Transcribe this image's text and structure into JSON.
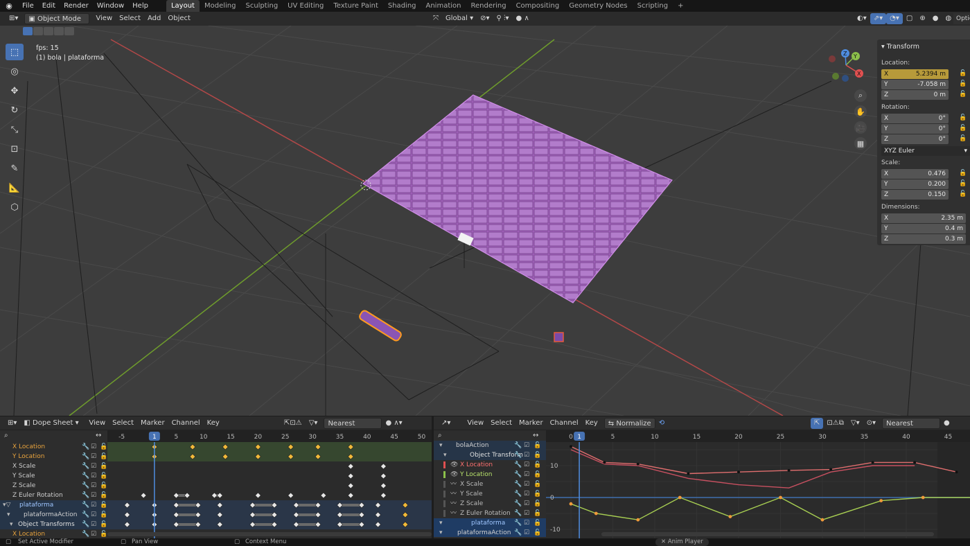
{
  "topbar": {
    "menus": [
      "File",
      "Edit",
      "Render",
      "Window",
      "Help"
    ],
    "workspaces": [
      "Layout",
      "Modeling",
      "Sculpting",
      "UV Editing",
      "Texture Paint",
      "Shading",
      "Animation",
      "Rendering",
      "Compositing",
      "Geometry Nodes",
      "Scripting"
    ],
    "active_workspace": "Layout",
    "add_tab": "+"
  },
  "viewport_header": {
    "mode": "Object Mode",
    "menus": [
      "View",
      "Select",
      "Add",
      "Object"
    ],
    "orientation": "Global",
    "options_label": "Optio"
  },
  "overlay": {
    "fps": "fps: 15",
    "object": "(1) bola | plataforma"
  },
  "gizmo": {
    "x": "X",
    "y": "Y",
    "z": "Z"
  },
  "npanel": {
    "title": "Transform",
    "location_label": "Location:",
    "location": [
      {
        "axis": "X",
        "value": "5.2394 m"
      },
      {
        "axis": "Y",
        "value": "-7.058 m"
      },
      {
        "axis": "Z",
        "value": "0 m"
      }
    ],
    "rotation_label": "Rotation:",
    "rotation": [
      {
        "axis": "X",
        "value": "0°"
      },
      {
        "axis": "Y",
        "value": "0°"
      },
      {
        "axis": "Z",
        "value": "0°"
      }
    ],
    "rotation_mode": "XYZ Euler",
    "scale_label": "Scale:",
    "scale": [
      {
        "axis": "X",
        "value": "0.476"
      },
      {
        "axis": "Y",
        "value": "0.200"
      },
      {
        "axis": "Z",
        "value": "0.150"
      }
    ],
    "dimensions_label": "Dimensions:",
    "dimensions": [
      {
        "axis": "X",
        "value": "2.35 m"
      },
      {
        "axis": "Y",
        "value": "0.4 m"
      },
      {
        "axis": "Z",
        "value": "0.3 m"
      }
    ]
  },
  "dopesheet": {
    "editor": "Dope Sheet",
    "menus": [
      "View",
      "Select",
      "Marker",
      "Channel",
      "Key"
    ],
    "snap": "Nearest Frame",
    "ruler": [
      "-5",
      "1",
      "5",
      "10",
      "15",
      "20",
      "25",
      "30",
      "35",
      "40",
      "45",
      "50"
    ],
    "current_frame": "1",
    "channels": [
      {
        "name": "X Location",
        "color": "#e8a33d",
        "indent": 18
      },
      {
        "name": "Y Location",
        "color": "#e8a33d",
        "indent": 18
      },
      {
        "name": "X Scale",
        "color": "#cccccc",
        "indent": 18
      },
      {
        "name": "Y Scale",
        "color": "#cccccc",
        "indent": 18
      },
      {
        "name": "Z Scale",
        "color": "#cccccc",
        "indent": 18
      },
      {
        "name": "Z Euler Rotation",
        "color": "#cccccc",
        "indent": 18
      },
      {
        "name": "plataforma",
        "color": "#9fc6ff",
        "indent": 28
      },
      {
        "name": "plataformaAction",
        "color": "#d0d0d0",
        "indent": 34
      },
      {
        "name": "Object Transforms",
        "color": "#e0e0e0",
        "indent": 26
      },
      {
        "name": "X Location",
        "color": "#e8a33d",
        "indent": 18
      }
    ]
  },
  "graph": {
    "menus": [
      "View",
      "Select",
      "Marker",
      "Channel",
      "Key"
    ],
    "normalize": "Normalize",
    "snap": "Nearest Frame",
    "ruler": [
      "0",
      "1",
      "5",
      "10",
      "15",
      "20",
      "25",
      "30",
      "35",
      "40",
      "45"
    ],
    "current_frame": "1",
    "y_labels": [
      "10",
      "0",
      "-10"
    ],
    "channels": [
      {
        "name": "bolaAction",
        "color": "#d0d0d0",
        "indent": 32
      },
      {
        "name": "Object Transform",
        "color": "#e0e0e0",
        "indent": 52
      },
      {
        "name": "X Location",
        "color": "#ff7070",
        "indent": 38
      },
      {
        "name": "Y Location",
        "color": "#b8e26b",
        "indent": 38
      },
      {
        "name": "X Scale",
        "color": "#bbbbbb",
        "indent": 38
      },
      {
        "name": "Y Scale",
        "color": "#bbbbbb",
        "indent": 38
      },
      {
        "name": "Z Scale",
        "color": "#bbbbbb",
        "indent": 38
      },
      {
        "name": "Z Euler Rotation",
        "color": "#bbbbbb",
        "indent": 38
      },
      {
        "name": "plataforma",
        "color": "#9fc6ff",
        "indent": 54
      },
      {
        "name": "plataformaAction",
        "color": "#d0d0d0",
        "indent": 34
      }
    ]
  },
  "status": {
    "left": "Set Active Modifier",
    "pan": "Pan View",
    "context": "Context Menu",
    "anim": "Anim Player"
  }
}
